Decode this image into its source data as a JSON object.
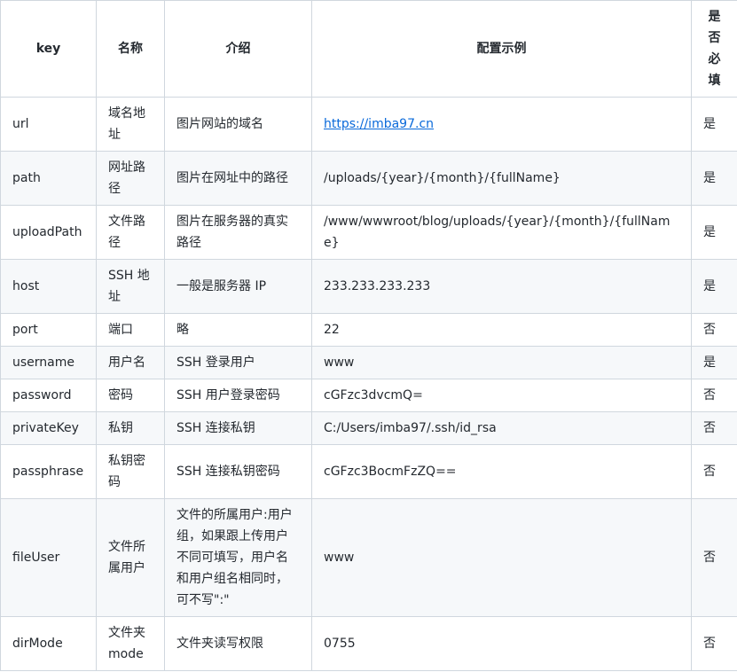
{
  "table": {
    "headers": [
      "key",
      "名称",
      "介绍",
      "配置示例",
      "是否必填"
    ],
    "rows": [
      {
        "key": "url",
        "name": "域名地址",
        "desc": "图片网站的域名",
        "example": "https://imba97.cn",
        "required": "是"
      },
      {
        "key": "path",
        "name": "网址路径",
        "desc": "图片在网址中的路径",
        "example": "/uploads/{year}/{month}/{fullName}",
        "required": "是"
      },
      {
        "key": "uploadPath",
        "name": "文件路径",
        "desc": "图片在服务器的真实路径",
        "example": "/www/wwwroot/blog/uploads/{year}/{month}/{fullName}",
        "required": "是"
      },
      {
        "key": "host",
        "name": "SSH 地址",
        "desc": "一般是服务器 IP",
        "example": "233.233.233.233",
        "required": "是"
      },
      {
        "key": "port",
        "name": "端口",
        "desc": "略",
        "example": "22",
        "required": "否"
      },
      {
        "key": "username",
        "name": "用户名",
        "desc": "SSH 登录用户",
        "example": "www",
        "required": "是"
      },
      {
        "key": "password",
        "name": "密码",
        "desc": "SSH 用户登录密码",
        "example": "cGFzc3dvcmQ=",
        "required": "否"
      },
      {
        "key": "privateKey",
        "name": "私钥",
        "desc": "SSH 连接私钥",
        "example": "C:/Users/imba97/.ssh/id_rsa",
        "required": "否"
      },
      {
        "key": "passphrase",
        "name": "私钥密码",
        "desc": "SSH 连接私钥密码",
        "example": "cGFzc3BocmFzZQ==",
        "required": "否"
      },
      {
        "key": "fileUser",
        "name": "文件所属用户",
        "desc": "文件的所属用户:用户组，如果跟上传用户不同可填写，用户名和用户组名相同时，可不写\":\"",
        "example": "www",
        "required": "否"
      },
      {
        "key": "dirMode",
        "name": "文件夹 mode",
        "desc": "文件夹读写权限",
        "example": "0755",
        "required": "否"
      }
    ]
  }
}
